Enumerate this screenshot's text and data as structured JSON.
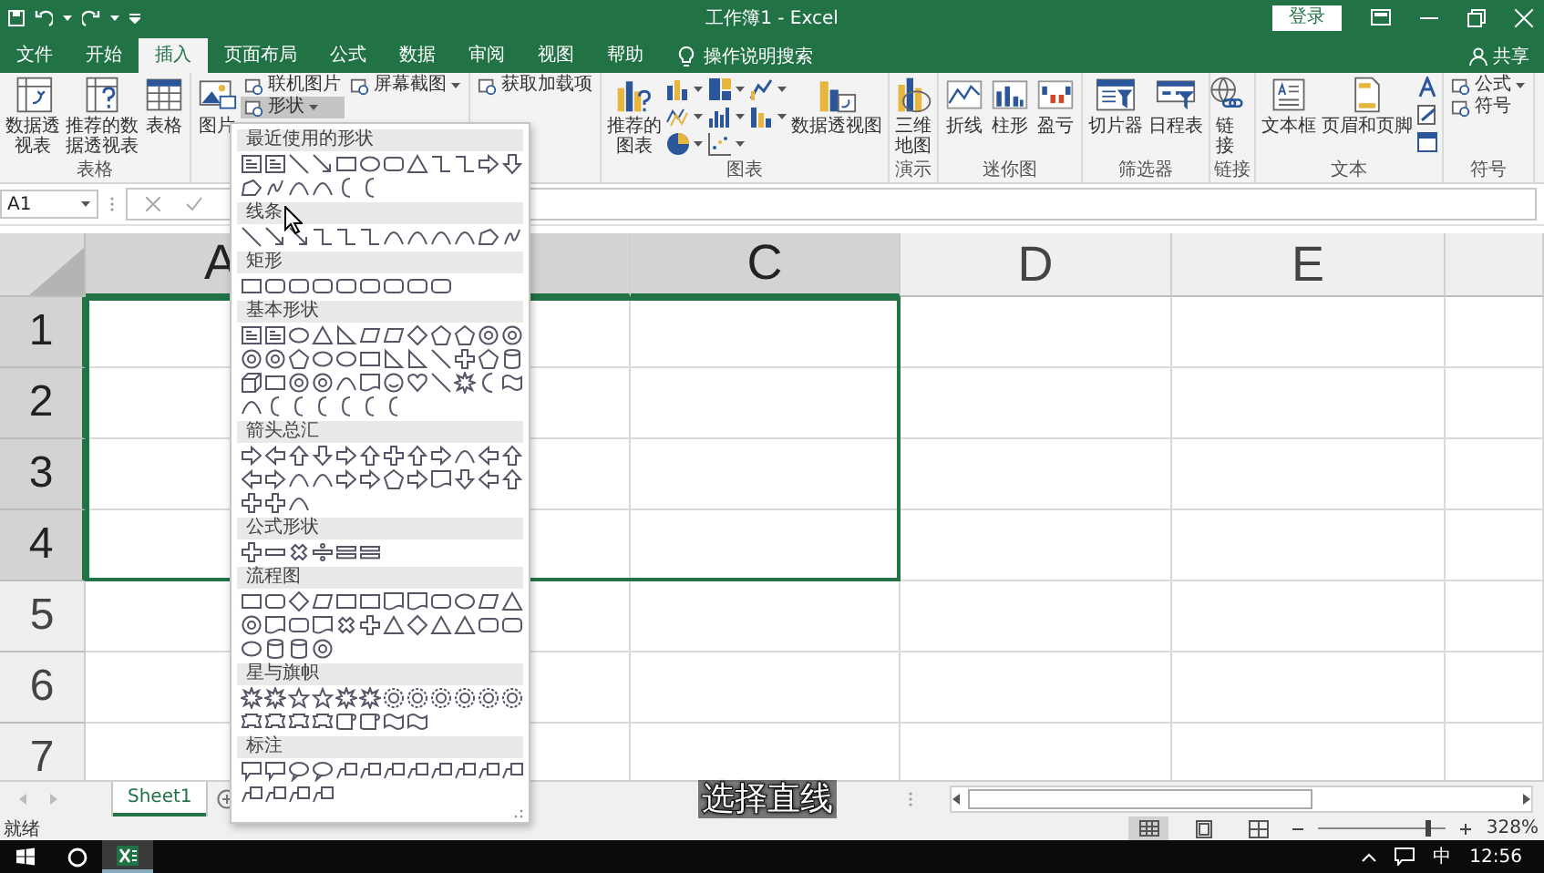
{
  "title_bar": {
    "title": "工作簿1 - Excel",
    "sign_in": "登录"
  },
  "tabs": [
    {
      "label": "文件",
      "selected": false
    },
    {
      "label": "开始",
      "selected": false
    },
    {
      "label": "插入",
      "selected": true
    },
    {
      "label": "页面布局",
      "selected": false
    },
    {
      "label": "公式",
      "selected": false
    },
    {
      "label": "数据",
      "selected": false
    },
    {
      "label": "审阅",
      "selected": false
    },
    {
      "label": "视图",
      "selected": false
    },
    {
      "label": "帮助",
      "selected": false
    }
  ],
  "tell_me": "操作说明搜索",
  "share": "共享",
  "ribbon": [
    {
      "label": "表格",
      "items": [
        {
          "kind": "wrapped",
          "label": "数据透视表"
        },
        {
          "kind": "wrapped",
          "label": "推荐的数据透视表"
        },
        {
          "kind": "large",
          "label": "表格"
        }
      ]
    },
    {
      "items": [
        {
          "kind": "large",
          "label": "图片"
        },
        {
          "kind": "stack",
          "items": [
            {
              "label": "联机图片",
              "pressed": false,
              "menu": false
            },
            {
              "label": "形状",
              "pressed": true,
              "menu": true
            }
          ]
        },
        {
          "kind": "stack",
          "items": [
            {
              "label": "屏幕截图",
              "pressed": false,
              "menu": true
            }
          ]
        }
      ]
    },
    {
      "items": [
        {
          "kind": "stack",
          "items": [
            {
              "label": "获取加载项",
              "pressed": false,
              "menu": false
            }
          ]
        }
      ]
    },
    {
      "label": "图表",
      "items": [
        {
          "kind": "wrapped",
          "label": "推荐的图表"
        },
        {
          "kind": "charts"
        },
        {
          "kind": "large",
          "label": "数据透视图"
        }
      ]
    },
    {
      "label": "演示",
      "items": [
        {
          "kind": "wrapped",
          "label": "三维地图"
        }
      ]
    },
    {
      "label": "迷你图",
      "items": [
        {
          "kind": "large",
          "label": "折线"
        },
        {
          "kind": "large",
          "label": "柱形"
        },
        {
          "kind": "large",
          "label": "盈亏"
        }
      ]
    },
    {
      "label": "筛选器",
      "items": [
        {
          "kind": "large",
          "label": "切片器"
        },
        {
          "kind": "large",
          "label": "日程表"
        }
      ]
    },
    {
      "label": "链接",
      "items": [
        {
          "kind": "wrapped",
          "label": "链接"
        }
      ]
    },
    {
      "label": "文本",
      "items": [
        {
          "kind": "large",
          "label": "文本框"
        },
        {
          "kind": "large",
          "label": "页眉和页脚"
        },
        {
          "kind": "tools"
        }
      ]
    },
    {
      "label": "符号",
      "items": [
        {
          "kind": "stack",
          "items": [
            {
              "label": "公式",
              "pressed": false,
              "menu": true
            },
            {
              "label": "符号",
              "pressed": false,
              "menu": false
            }
          ]
        }
      ]
    }
  ],
  "name_box": "A1",
  "columns": [
    {
      "label": "A",
      "selected": true
    },
    {
      "selected": true
    },
    {
      "label": "C",
      "selected": true
    },
    {
      "label": "D",
      "selected": false
    },
    {
      "label": "E",
      "selected": false
    },
    {
      "selected": false
    }
  ],
  "rows": [
    {
      "label": "1",
      "selected": true
    },
    {
      "label": "2",
      "selected": true
    },
    {
      "label": "3",
      "selected": true
    },
    {
      "label": "4",
      "selected": true
    },
    {
      "label": "5",
      "selected": false
    },
    {
      "label": "6",
      "selected": false
    },
    {
      "label": "7",
      "selected": false
    }
  ],
  "sheets": [
    {
      "label": "Sheet1",
      "selected": true
    }
  ],
  "status": "就绪",
  "zoom": {
    "level": 0.85,
    "reading": "328%"
  },
  "taskbar": {
    "ime": "中",
    "time": "12:56"
  },
  "subtitle": "选择直线",
  "shape_gallery": [
    {
      "title": "最近使用的形状"
    },
    {
      "title": "线条"
    },
    {
      "title": "矩形"
    },
    {
      "title": "基本形状"
    },
    {
      "title": "箭头总汇"
    },
    {
      "title": "公式形状"
    },
    {
      "title": "流程图"
    },
    {
      "title": "星与旗帜"
    },
    {
      "title": "标注"
    }
  ]
}
